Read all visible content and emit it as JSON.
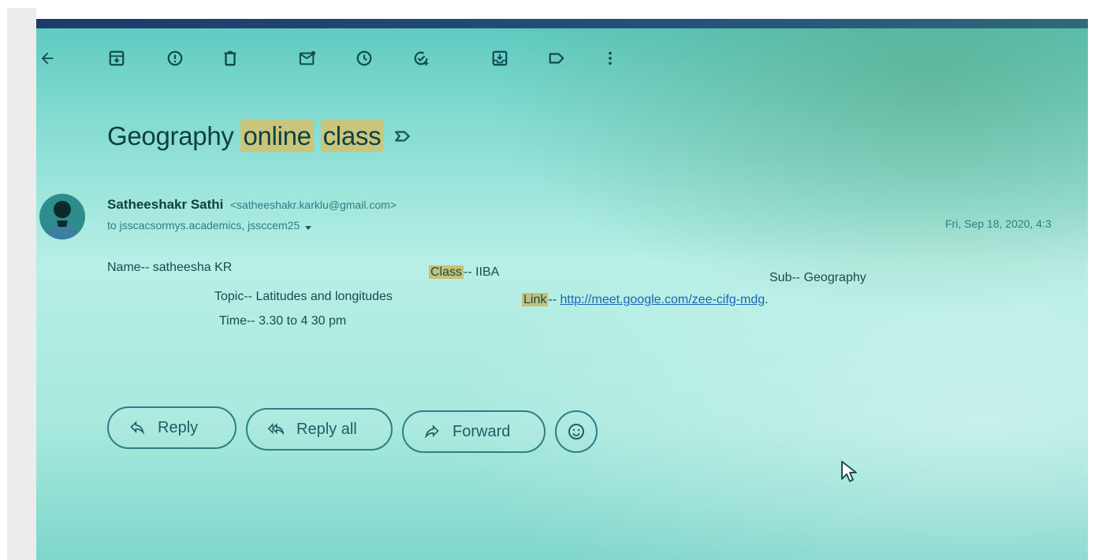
{
  "toolbar": {
    "icons": [
      "back-arrow-icon",
      "archive-icon",
      "report-spam-icon",
      "delete-icon",
      "mark-unread-icon",
      "snooze-icon",
      "add-to-tasks-icon",
      "move-to-icon",
      "label-icon",
      "more-icon"
    ]
  },
  "email": {
    "subject_part1": "Geography ",
    "subject_part2": "online",
    "subject_part3": " ",
    "subject_part4": "class",
    "sender_name": "Satheeshakr Sathi",
    "sender_email": "<satheeshakr.karklu@gmail.com>",
    "recipients": "to jsscacsormys.academics, jssccem25",
    "date": "Fri, Sep 18, 2020, 4:3",
    "body": {
      "name": "Name-- satheesha KR",
      "class_label": "Class",
      "class_value": "-- IIBA",
      "sub": "Sub-- Geography",
      "topic": "Topic-- Latitudes and longitudes",
      "link_label": "Link",
      "link_sep": "-- ",
      "link_url": "http://meet.google.com/zee-cifg-mdg",
      "link_tail": ".",
      "time": "Time-- 3.30 to 4 30 pm"
    }
  },
  "actions": {
    "reply": "Reply",
    "reply_all": "Reply all",
    "forward": "Forward"
  },
  "colors": {
    "highlight": "#c9c67c",
    "link": "#1c63b8",
    "accent": "#2c7f84"
  }
}
